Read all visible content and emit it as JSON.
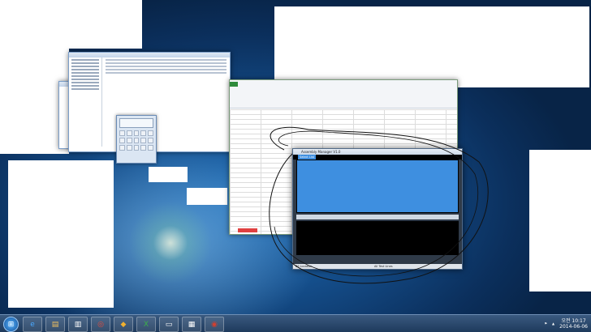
{
  "desktop": {
    "accent_colors": {
      "taskbar": "#1e3a5c",
      "asm_blue": "#3e8fe0",
      "excel_green": "#2f8b3b"
    }
  },
  "windows": {
    "explorer": {
      "icon": "folder-icon"
    },
    "calculator": {
      "icon": "calculator-icon"
    },
    "excel": {
      "icon": "excel-icon",
      "sheet_tab_color": "#e04040"
    },
    "asm": {
      "title": "Assembly Manager V1.0",
      "tabs": [
        "Select List",
        "",
        "",
        ""
      ],
      "status_left": "BS Location",
      "status_mid": "All Test Lines"
    }
  },
  "taskbar": {
    "start_icon": "windows-start-icon",
    "pinned": [
      {
        "name": "ie-icon",
        "glyph": "e"
      },
      {
        "name": "folder-icon",
        "glyph": "▤"
      },
      {
        "name": "files-icon",
        "glyph": "▥"
      },
      {
        "name": "chrome-icon",
        "glyph": "◎"
      },
      {
        "name": "app-icon",
        "glyph": "◆"
      },
      {
        "name": "excel-icon",
        "glyph": "X"
      },
      {
        "name": "window-icon",
        "glyph": "▭"
      },
      {
        "name": "apps-icon",
        "glyph": "▦"
      },
      {
        "name": "game-icon",
        "glyph": "◉"
      }
    ],
    "clock_time": "오전 10:17",
    "clock_date": "2014-06-06"
  }
}
